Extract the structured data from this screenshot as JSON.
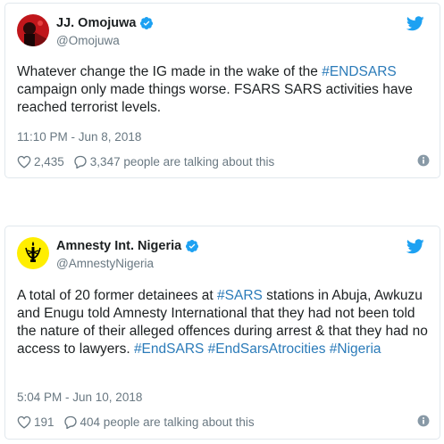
{
  "tweets": [
    {
      "display_name": "JJ. Omojuwa",
      "handle": "@Omojuwa",
      "text_parts": [
        "Whatever change the IG made in the wake of the ",
        "#ENDSARS",
        " campaign only made things worse. FSARS SARS activities have reached terrorist levels."
      ],
      "timestamp": "11:10 PM - Jun 8, 2018",
      "likes": "2,435",
      "replies_text": "3,347 people are talking about this",
      "avatar_icon": "avatar-red-portrait",
      "verified_icon": "verified-badge-icon",
      "brand_icon": "twitter-bird-icon"
    },
    {
      "display_name": "Amnesty Int. Nigeria",
      "handle": "@AmnestyNigeria",
      "text_parts": [
        "A total of 20 former detainees at ",
        "#SARS",
        " stations in Abuja, Awkuzu and Enugu told Amnesty International that they had not been told the nature of their alleged offences during arrest & that they had no access to lawyers. ",
        "#EndSARS",
        " ",
        "#EndSarsAtrocities",
        " ",
        "#Nigeria"
      ],
      "timestamp": "5:04 PM - Jun 10, 2018",
      "likes": "191",
      "replies_text": "404 people are talking about this",
      "avatar_icon": "amnesty-candle-logo",
      "verified_icon": "verified-badge-icon",
      "brand_icon": "twitter-bird-icon"
    }
  ],
  "colors": {
    "hashtag": "#2b7bb9",
    "meta": "#697882",
    "verified": "#1da1f2",
    "amnesty_yellow": "#ffee00",
    "border": "#e1e8ed"
  }
}
